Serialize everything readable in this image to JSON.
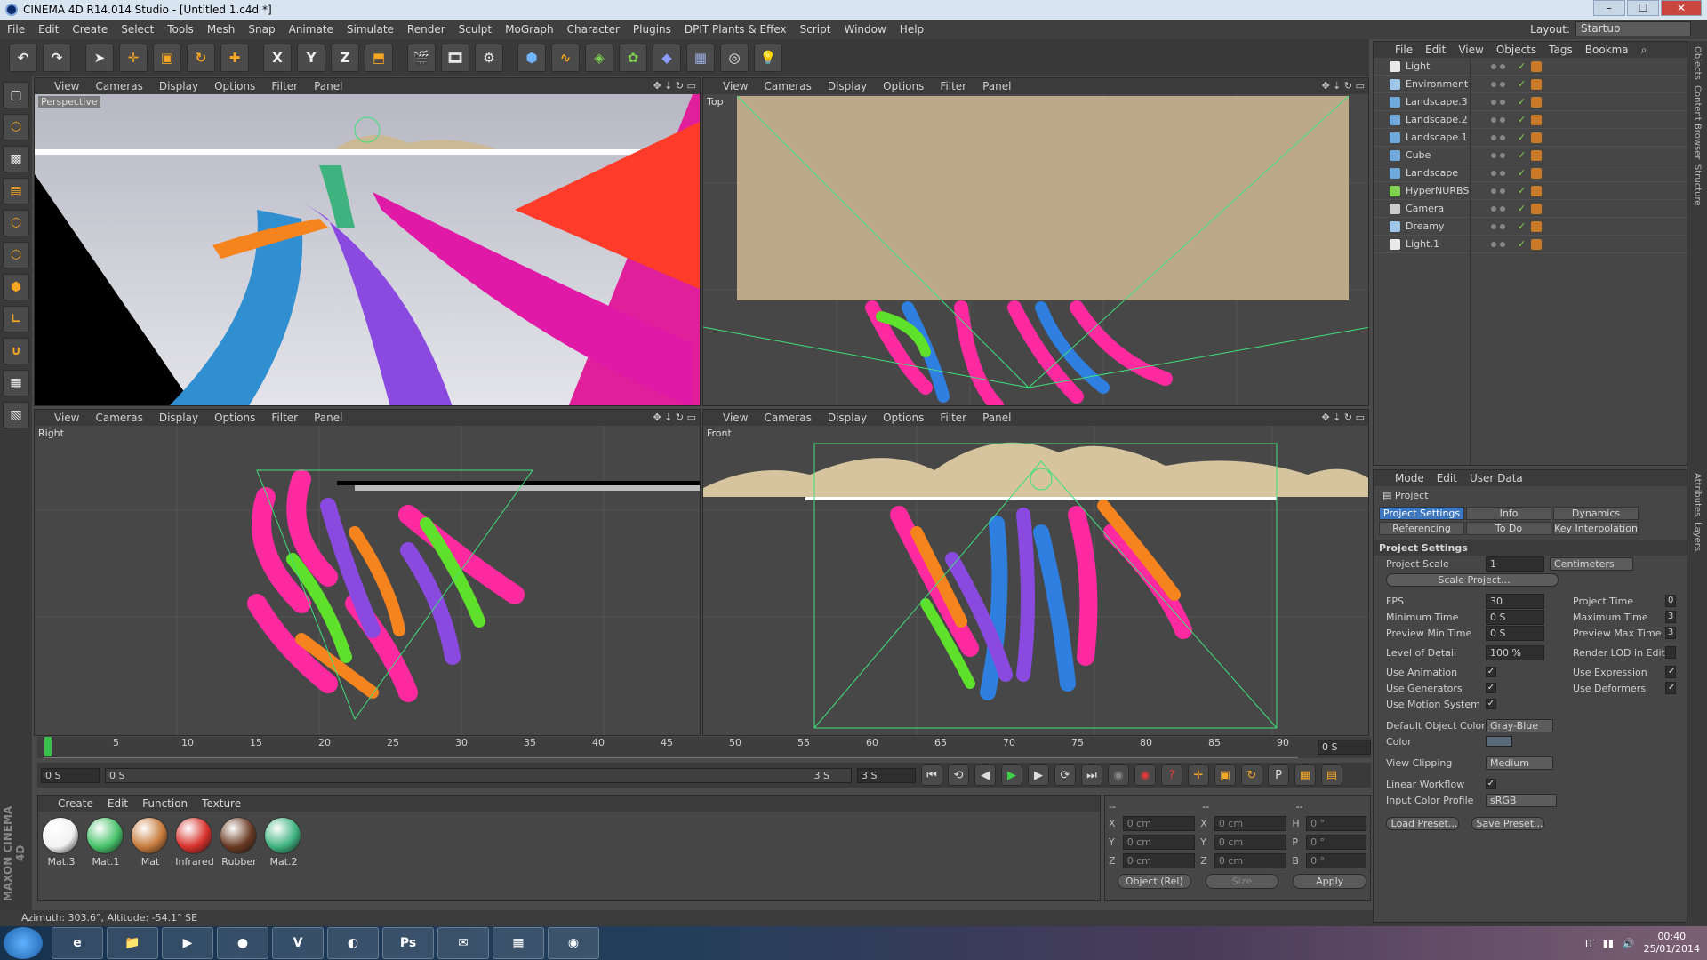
{
  "window": {
    "title": "CINEMA 4D R14.014 Studio - [Untitled 1.c4d *]",
    "controls": [
      "–",
      "☐",
      "✕"
    ]
  },
  "menu": [
    "File",
    "Edit",
    "Create",
    "Select",
    "Tools",
    "Mesh",
    "Snap",
    "Animate",
    "Simulate",
    "Render",
    "Sculpt",
    "MoGraph",
    "Character",
    "Plugins",
    "DPIT Plants & Effex",
    "Script",
    "Window",
    "Help"
  ],
  "layout": {
    "label": "Layout:",
    "value": "Startup"
  },
  "toolbar": {
    "undo": "undo-icon",
    "redo": "redo-icon",
    "axis_x": "X",
    "axis_y": "Y",
    "axis_z": "Z"
  },
  "viewport_menu": [
    "View",
    "Cameras",
    "Display",
    "Options",
    "Filter",
    "Panel"
  ],
  "viewports": [
    {
      "name": "Perspective"
    },
    {
      "name": "Top"
    },
    {
      "name": "Right"
    },
    {
      "name": "Front"
    }
  ],
  "timeline": {
    "ticks": [
      "0",
      "5",
      "10",
      "15",
      "20",
      "25",
      "30",
      "35",
      "40",
      "45",
      "50",
      "55",
      "60",
      "65",
      "70",
      "75",
      "80",
      "85",
      "90"
    ],
    "end_field": "0 S"
  },
  "transport": {
    "start": "0 S",
    "range_start": "0 S",
    "range_end": "3 S",
    "end": "3 S"
  },
  "materials": {
    "menu": [
      "Create",
      "Edit",
      "Function",
      "Texture"
    ],
    "items": [
      {
        "name": "Mat.3",
        "color": "#f2f2f2"
      },
      {
        "name": "Mat.1",
        "color": "#47c26a"
      },
      {
        "name": "Mat",
        "color": "#c77b3c"
      },
      {
        "name": "Infrared",
        "color": "#d8312c"
      },
      {
        "name": "Rubber",
        "color": "#6a3a22"
      },
      {
        "name": "Mat.2",
        "color": "#3fb37f"
      }
    ]
  },
  "coordinates": {
    "header": [
      "--",
      "--",
      "--"
    ],
    "rows": [
      {
        "a": "X",
        "av": "0 cm",
        "b": "X",
        "bv": "0 cm",
        "c": "H",
        "cv": "0 °"
      },
      {
        "a": "Y",
        "av": "0 cm",
        "b": "Y",
        "bv": "0 cm",
        "c": "P",
        "cv": "0 °"
      },
      {
        "a": "Z",
        "av": "0 cm",
        "b": "Z",
        "bv": "0 cm",
        "c": "B",
        "cv": "0 °"
      }
    ],
    "mode": "Object (Rel)",
    "size": "Size",
    "apply": "Apply"
  },
  "status": "Azimuth: 303.6°, Altitude: -54.1° SE",
  "objects": {
    "menu": [
      "File",
      "Edit",
      "View",
      "Objects",
      "Tags",
      "Bookma"
    ],
    "items": [
      {
        "name": "Light",
        "color": "#e8e8e8"
      },
      {
        "name": "Environment",
        "color": "#9fc5e8"
      },
      {
        "name": "Landscape.3",
        "color": "#6fa8dc"
      },
      {
        "name": "Landscape.2",
        "color": "#6fa8dc"
      },
      {
        "name": "Landscape.1",
        "color": "#6fa8dc"
      },
      {
        "name": "Cube",
        "color": "#6fa8dc"
      },
      {
        "name": "Landscape",
        "color": "#6fa8dc"
      },
      {
        "name": "HyperNURBS",
        "color": "#7ed04f"
      },
      {
        "name": "Camera",
        "color": "#cccccc"
      },
      {
        "name": "Dreamy",
        "color": "#9fc5e8"
      },
      {
        "name": "Light.1",
        "color": "#e8e8e8"
      }
    ]
  },
  "attributes": {
    "menu": [
      "Mode",
      "Edit",
      "User Data"
    ],
    "object": "Project",
    "tabs": [
      "Project Settings",
      "Info",
      "Dynamics",
      "Referencing",
      "To Do",
      "Key Interpolation"
    ],
    "section": "Project Settings",
    "project_scale": {
      "label": "Project Scale",
      "value": "1",
      "unit": "Centimeters"
    },
    "scale_button": "Scale Project...",
    "fps": {
      "label": "FPS",
      "value": "30"
    },
    "min_time": {
      "label": "Minimum Time",
      "value": "0 S"
    },
    "preview_min": {
      "label": "Preview Min Time",
      "value": "0 S"
    },
    "lod": {
      "label": "Level of Detail",
      "value": "100 %"
    },
    "project_time": {
      "label": "Project Time",
      "value": "0"
    },
    "max_time": {
      "label": "Maximum Time",
      "value": "3"
    },
    "preview_max": {
      "label": "Preview Max Time",
      "value": "3"
    },
    "render_lod": "Render LOD in Editor",
    "use_animation": "Use Animation",
    "use_generators": "Use Generators",
    "use_motion": "Use Motion System",
    "use_expression": "Use Expression",
    "use_deformers": "Use Deformers",
    "default_color": {
      "label": "Default Object Color",
      "value": "Gray-Blue"
    },
    "color_label": "Color",
    "view_clipping": {
      "label": "View Clipping",
      "value": "Medium"
    },
    "linear_workflow": "Linear Workflow",
    "input_profile": {
      "label": "Input Color Profile",
      "value": "sRGB"
    },
    "load_preset": "Load Preset...",
    "save_preset": "Save Preset..."
  },
  "side_tabs": [
    "Objects",
    "Content Browser",
    "Structure",
    "Attributes",
    "Layers"
  ],
  "taskbar": {
    "apps": [
      "e",
      "📁",
      "▶",
      "●",
      "V",
      "◐",
      "Ps",
      "✉",
      "▦",
      "◉"
    ],
    "lang": "IT",
    "time": "00:40",
    "date": "25/01/2014"
  }
}
